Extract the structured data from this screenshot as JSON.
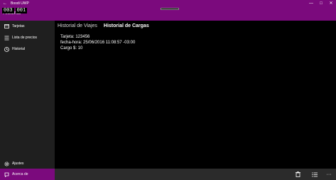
{
  "window": {
    "title": "Boodi UWP",
    "back_glyph": "←",
    "minimize_glyph": "—",
    "maximize_glyph": "□",
    "close_glyph": "✕"
  },
  "header": {
    "page_title": "Historial",
    "counters": [
      "003",
      "001"
    ]
  },
  "sidebar": {
    "items": [
      {
        "label": "Tarjetas",
        "icon": "card-icon"
      },
      {
        "label": "Lista de precios",
        "icon": "list-icon"
      },
      {
        "label": "Historial",
        "icon": "history-icon"
      }
    ],
    "footer_items": [
      {
        "label": "Ajustes",
        "icon": "gear-icon"
      },
      {
        "label": "Acerca de",
        "icon": "info-icon",
        "active": true
      }
    ]
  },
  "main": {
    "tabs": [
      {
        "label": "Historial de Viajes",
        "selected": false
      },
      {
        "label": "Historial de Cargas",
        "selected": true
      }
    ],
    "details": {
      "card": "Tarjeta: 123456",
      "datetime": "fecha-hora: 25/06/2016 11:08:57 -03:00",
      "charge": "Cargo $: 10"
    }
  },
  "bottombar": {
    "buttons": [
      "trash-icon",
      "list-view-icon",
      "more-icon"
    ],
    "more_glyph": "···"
  },
  "colors": {
    "accent": "#7b0a7d",
    "sidebar": "#1f1f1f",
    "bottombar": "#2b2b2b",
    "background": "#000000"
  }
}
